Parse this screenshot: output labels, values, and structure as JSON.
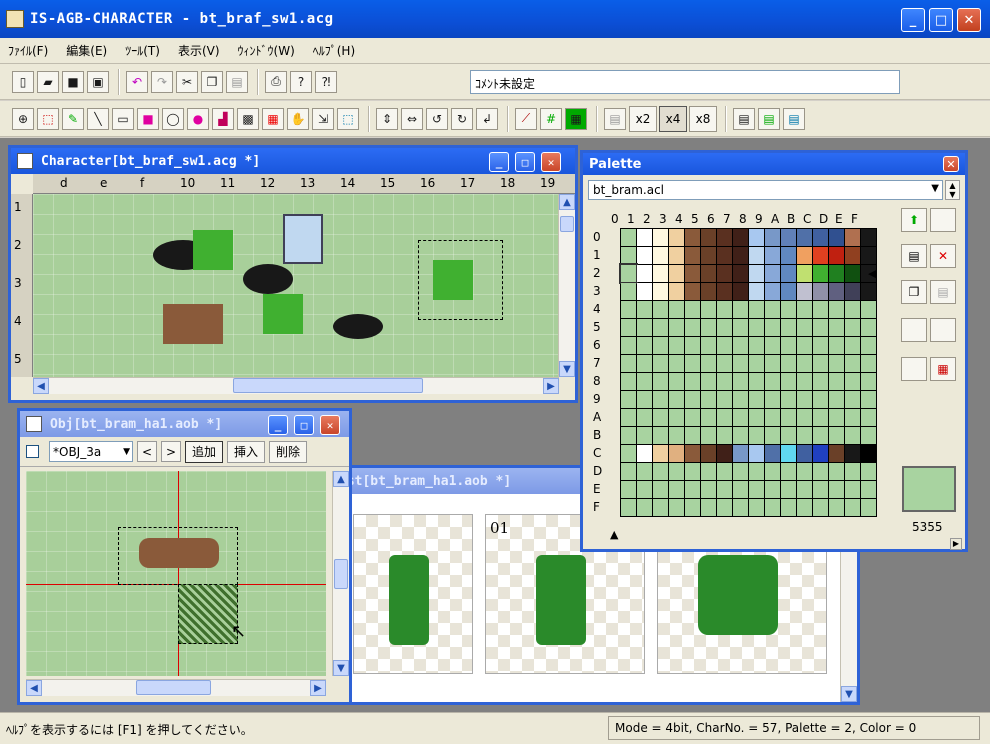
{
  "window": {
    "title": "IS-AGB-CHARACTER - bt_braf_sw1.acg"
  },
  "menu": [
    "ﾌｧｲﾙ(F)",
    "編集(E)",
    "ﾂｰﾙ(T)",
    "表示(V)",
    "ｳｨﾝﾄﾞｳ(W)",
    "ﾍﾙﾌﾟ(H)"
  ],
  "comment": {
    "value": "ｺﾒﾝﾄ未設定"
  },
  "zoom": {
    "options": [
      "x2",
      "x4",
      "x8"
    ],
    "selected": "x4"
  },
  "character_window": {
    "title": "Character[bt_braf_sw1.acg *]",
    "ruler_x": [
      "d",
      "e",
      "f",
      "10",
      "11",
      "12",
      "13",
      "14",
      "15",
      "16",
      "17",
      "18",
      "19"
    ],
    "ruler_y": [
      "1",
      "2",
      "3",
      "4",
      "5"
    ]
  },
  "obj_window": {
    "title": "Obj[bt_bram_ha1.aob *]",
    "select_value": "*OBJ_3a",
    "buttons": {
      "prev": "<",
      "next": ">",
      "add": "追加",
      "insert": "挿入",
      "delete": "削除"
    }
  },
  "list_window": {
    "title": "ist[bt_bram_ha1.aob *]",
    "frames": [
      "",
      "01",
      ""
    ]
  },
  "palette_window": {
    "title": "Palette",
    "file": "bt_bram.acl",
    "col_headers": [
      "0",
      "1",
      "2",
      "3",
      "4",
      "5",
      "6",
      "7",
      "8",
      "9",
      "A",
      "B",
      "C",
      "D",
      "E",
      "F"
    ],
    "row_headers": [
      "0",
      "1",
      "2",
      "3",
      "4",
      "5",
      "6",
      "7",
      "8",
      "9",
      "A",
      "B",
      "C",
      "D",
      "E",
      "F"
    ],
    "color_value": "5355",
    "preview_color": "#a8d3a0",
    "rows": [
      [
        "#a8d3a0",
        "#ffffff",
        "#fff8e0",
        "#f0d0a0",
        "#8a5a3a",
        "#6a4028",
        "#5a3020",
        "#402018",
        "#a8c8f0",
        "#7898c8",
        "#6080b8",
        "#5070a8",
        "#4060a0",
        "#305090",
        "#b07050",
        "#181818"
      ],
      [
        "#a8d3a0",
        "#ffffff",
        "#fff8e0",
        "#f0d0a0",
        "#8a5a3a",
        "#6a4028",
        "#5a3020",
        "#402018",
        "#c0d8f0",
        "#88a8d8",
        "#6088c0",
        "#f0a060",
        "#e04020",
        "#c02010",
        "#904020",
        "#181818"
      ],
      [
        "#a8d3a0",
        "#ffffff",
        "#fff8e0",
        "#f0d0a0",
        "#8a5a3a",
        "#6a4028",
        "#5a3020",
        "#402018",
        "#c0d8f0",
        "#88a8d8",
        "#6088c0",
        "#c0e070",
        "#40b030",
        "#208020",
        "#105010",
        "#181818"
      ],
      [
        "#a8d3a0",
        "#ffffff",
        "#fff8e0",
        "#f0d0a0",
        "#8a5a3a",
        "#6a4028",
        "#5a3020",
        "#402018",
        "#c0d8f0",
        "#88a8d8",
        "#6088c0",
        "#c0c0d0",
        "#9090a8",
        "#606080",
        "#404058",
        "#181818"
      ],
      [
        "#a8d3a0"
      ],
      [
        "#a8d3a0"
      ],
      [
        "#a8d3a0"
      ],
      [
        "#a8d3a0"
      ],
      [
        "#a8d3a0"
      ],
      [
        "#a8d3a0"
      ],
      [
        "#a8d3a0"
      ],
      [
        "#a8d3a0"
      ],
      [
        "#a8d3a0",
        "#ffffff",
        "#f0d0a0",
        "#e0b080",
        "#8a5a3a",
        "#6a4028",
        "#402018",
        "#7898c8",
        "#a8c8f0",
        "#5070a8",
        "#60d8f0",
        "#4060a0",
        "#2040c0",
        "#6a4028",
        "#181818",
        "#000000"
      ],
      [
        "#a8d3a0"
      ],
      [
        "#a8d3a0"
      ],
      [
        "#a8d3a0"
      ]
    ]
  },
  "status": {
    "help": "ﾍﾙﾌﾟを表示するには [F1] を押してください。",
    "info": "Mode = 4bit, CharNo. = 57, Palette = 2, Color = 0"
  }
}
